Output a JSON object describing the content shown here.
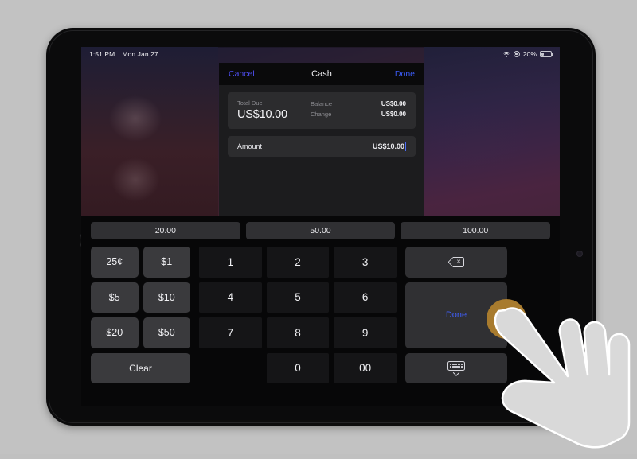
{
  "status_bar": {
    "time": "1:51 PM",
    "date": "Mon Jan 27",
    "wifi_icon": "wifi-icon",
    "lock_icon": "rotation-lock-icon",
    "battery_percent": "20%",
    "battery_icon": "battery-icon"
  },
  "sheet": {
    "cancel_label": "Cancel",
    "title": "Cash",
    "done_label": "Done",
    "totals": {
      "total_due_label": "Total Due",
      "total_due_value": "US$10.00",
      "balance_label": "Balance",
      "balance_value": "US$0.00",
      "change_label": "Change",
      "change_value": "US$0.00"
    },
    "amount": {
      "label": "Amount",
      "value": "US$10.00"
    }
  },
  "keyboard": {
    "quick_amounts": [
      "20.00",
      "50.00",
      "100.00"
    ],
    "denominations": [
      "25¢",
      "$1",
      "$5",
      "$10",
      "$20",
      "$50"
    ],
    "clear_label": "Clear",
    "numbers": [
      "1",
      "2",
      "3",
      "4",
      "5",
      "6",
      "7",
      "8",
      "9",
      "0",
      "00"
    ],
    "actions": {
      "backspace_icon": "backspace-icon",
      "done_label": "Done",
      "dismiss_keyboard_icon": "keyboard-dismiss-icon"
    }
  },
  "cursor": {
    "type": "pointing-hand",
    "tap_target": "Done",
    "ring_color": "#a87b2e",
    "hand_color": "#d9d9d9"
  },
  "theme": {
    "accent_blue": "#3f5ef6",
    "sheet_bg": "#1c1c1e",
    "card_bg": "#2c2c2e",
    "key_bg": "#3a3a3d",
    "numkey_bg": "#151517"
  }
}
